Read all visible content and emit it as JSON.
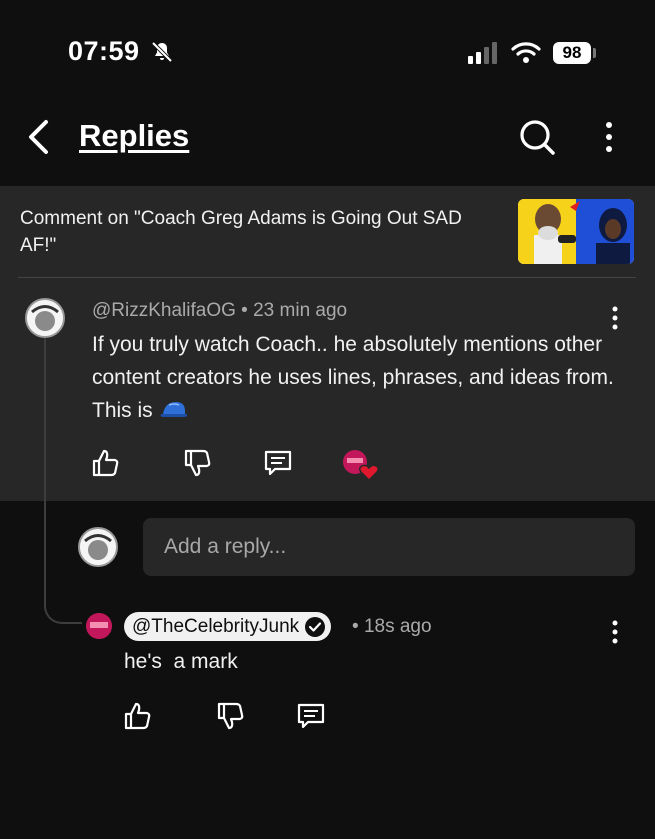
{
  "status_bar": {
    "time": "07:59",
    "battery": "98"
  },
  "header": {
    "title": "Replies"
  },
  "banner": {
    "text": "Comment on \"Coach Greg Adams is Going Out SAD AF!\""
  },
  "comment": {
    "author": "@RizzKhalifaOG",
    "age": "23 min ago",
    "text": "If you truly watch Coach.. he absolutely mentions other content creators he uses lines, phrases, and ideas from. This is"
  },
  "reply_box": {
    "placeholder": "Add a reply..."
  },
  "reply": {
    "author": "@TheCelebrityJunk",
    "age": "18s ago",
    "text": "he's  a mark"
  },
  "colors": {
    "background": "#0f0f0f",
    "surface": "#272727",
    "secondary_text": "#aaaaaa",
    "heart": "#e0182d"
  }
}
